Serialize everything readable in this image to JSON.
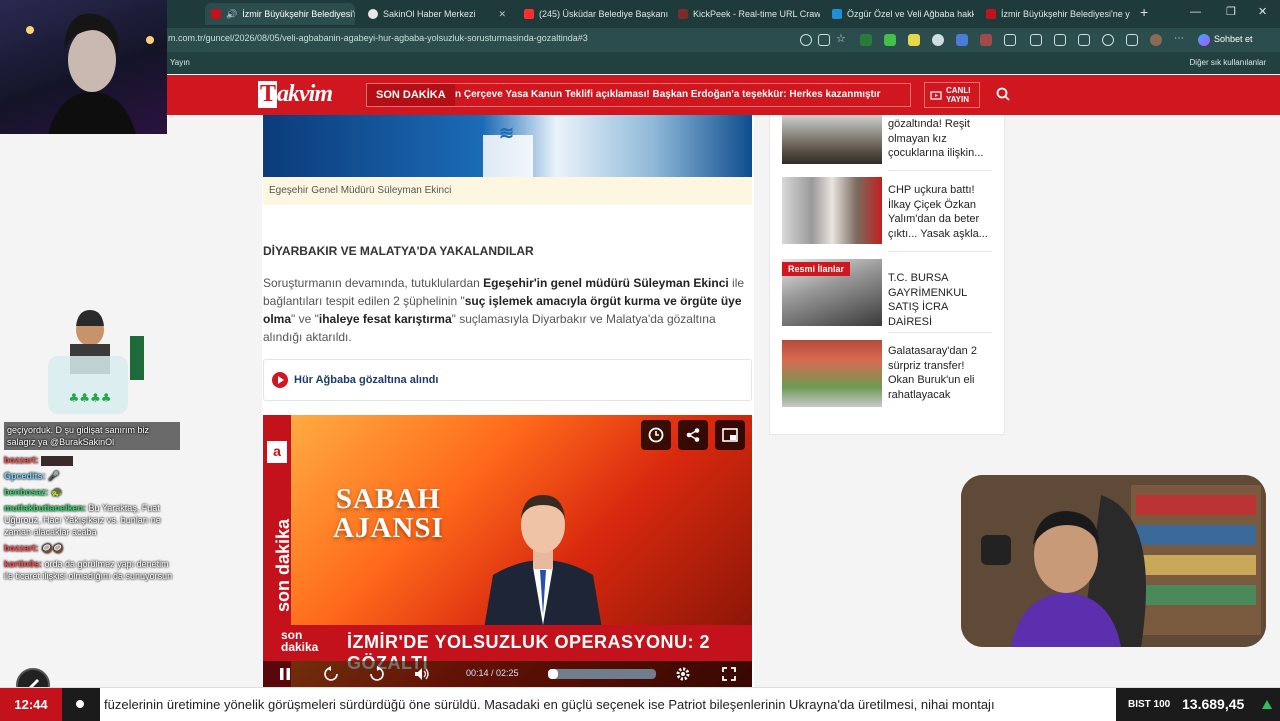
{
  "browser": {
    "tabs": [
      {
        "label": "İzmir Büyükşehir Belediyesi'n",
        "fav": "#c3121b",
        "active": true
      },
      {
        "label": "SakinOl Haber Merkezi",
        "fav": "#e8e8e8",
        "active": false
      },
      {
        "label": "(245) Üsküdar Belediye Başkanı S",
        "fav": "#ff2d2d",
        "active": false
      },
      {
        "label": "KickPeek - Real-time URL Crawler",
        "fav": "#7a2b2b",
        "active": false
      },
      {
        "label": "Özgür Özel ve Veli Ağbaba hakk",
        "fav": "#1f8fd6",
        "active": false
      },
      {
        "label": "İzmir Büyükşehir Belediyesi'ne ye",
        "fav": "#c3121b",
        "active": false
      }
    ],
    "url": "m.com.tr/guncel/2026/08/05/veli-agbabanin-agabeyi-hur-agbaba-yolsuzluk-sorusturmasinda-gozaltinda#3",
    "bookmark_left": "Yayın",
    "bookmark_right": "Diğer sık kullanılanlar",
    "chat_button": "Sohbet et"
  },
  "site": {
    "logo": "akvim",
    "logo_prefix": "T",
    "breaking_label": "SON DAKİKA",
    "breaking_text": "n Çerçeve Yasa Kanun Teklifi açıklaması! Başkan Erdoğan'a teşekkür: Herkes kazanmıştır",
    "live_label_1": "CANLI",
    "live_label_2": "YAYIN"
  },
  "article": {
    "hero_caption": "Egeşehir Genel Müdürü Süleyman Ekinci",
    "section_title": "DİYARBAKIR VE MALATYA'DA YAKALANDILAR",
    "para_1": "Soruşturmanın devamında, tutuklulardan ",
    "para_b1": "Egeşehir'in genel müdürü Süleyman Ekinci",
    "para_2": " ile bağlantıları tespit edilen 2 şüphelinin \"",
    "para_b2": "suç işlemek amacıyla örgüt kurma ve örgüte üye olma",
    "para_3": "\" ve \"",
    "para_b3": "ihaleye fesat karıştırma",
    "para_4": "\" suçlamasıyla Diyarbakır ve Malatya'da gözaltına alındığı aktarıldı.",
    "related_link": "Hür Ağbaba gözaltına alındı"
  },
  "video": {
    "side_text": "son dakika",
    "title_1": "SABAH",
    "title_2": "AJANSI",
    "lower_tag_1": "son",
    "lower_tag_2": "dakika",
    "lower_text": "İZMİR'DE YOLSUZLUK OPERASYONU: 2 GÖZALTI",
    "time": "00:14 / 02:25",
    "progress": 0.097
  },
  "sidebar": {
    "items": [
      {
        "text": "gözaltında! Reşit olmayan kız çocuklarına ilişkin...",
        "badge": ""
      },
      {
        "text": "CHP uçkura battı! İlkay Çiçek Özkan Yalım'dan da beter çıktı... Yasak aşkla...",
        "badge": ""
      },
      {
        "text": "T.C. BURSA GAYRİMENKUL SATIŞ İCRA DAİRESİ",
        "badge": "Resmi İlanlar"
      },
      {
        "text": "Galatasaray'dan 2 sürpriz transfer! Okan Buruk'un eli rahatlayacak",
        "badge": ""
      }
    ]
  },
  "chat": [
    {
      "user": "",
      "text": "geçiyorduk. D şu gidişat sanırım biz salagız ya @BurakSakinOl",
      "boxed": true
    },
    {
      "user": "bozzart:",
      "text": "",
      "cls": ""
    },
    {
      "user": "Gpcedits:",
      "text": "",
      "cls": "b"
    },
    {
      "user": "benbosaz:",
      "text": "",
      "cls": "g"
    },
    {
      "user": "mutlakbutlanelken:",
      "text": "Bu Yaraktaş, Fuat Uğurouz, Hacı Yakışıksız vs. bunları ne zaman alacaklar acaba",
      "cls": "g"
    },
    {
      "user": "bozzart:",
      "text": "",
      "cls": ""
    },
    {
      "user": "kortin0s:",
      "text": "orda da görülmez yapı denetim ile ticaret ilişkisi olmadığını da sunuyorsun",
      "cls": ""
    }
  ],
  "ticker": {
    "time": "12:44",
    "text": "füzelerinin üretimine yönelik görüşmeleri sürdürdüğü öne sürüldü. Masadaki en güçlü seçenek ise Patriot bileşenlerinin Ukrayna'da üretilmesi, nihai montajı",
    "bist_label": "BIST 100",
    "bist_value": "13.689,45"
  },
  "colors": {
    "brand": "#d0161e",
    "navy": "#1e3a6f",
    "up": "#2fbe5a"
  }
}
